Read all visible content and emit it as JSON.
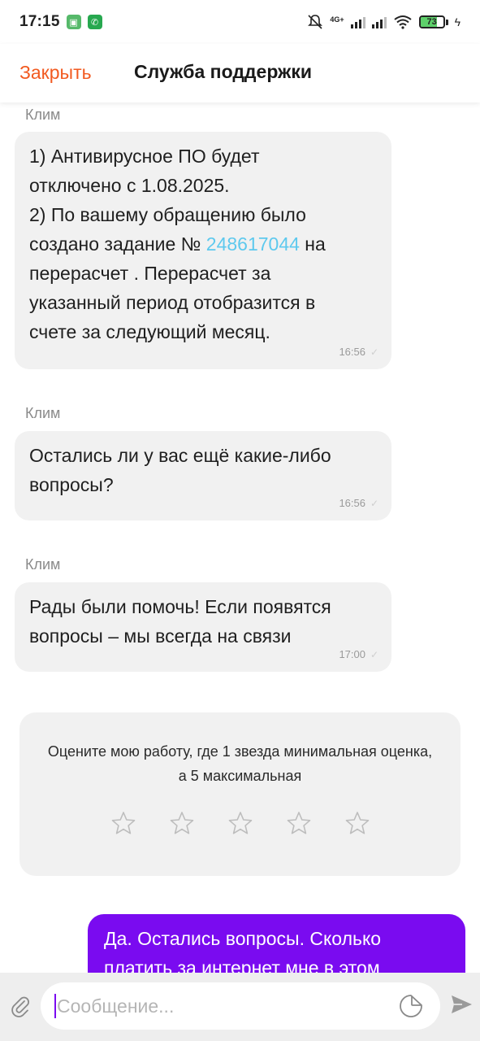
{
  "status_bar": {
    "time": "17:15",
    "network": "4G+",
    "battery": "73",
    "battery_level": 0.73
  },
  "header": {
    "close_label": "Закрыть",
    "title": "Служба поддержки"
  },
  "messages": [
    {
      "sender": "Клим",
      "text_before": "1) Антивирусное ПО будет\nотключено с 1.08.2025.\n2) По вашему обращению было\nсоздано задание № ",
      "link": "248617044",
      "text_after": " на\nперерасчет . Перерасчет за\nуказанный период отобразится в\nсчете за следующий месяц.",
      "time": "16:56"
    },
    {
      "sender": "Клим",
      "text": "Остались ли у вас ещё какие-либо\nвопросы?",
      "time": "16:56"
    },
    {
      "sender": "Клим",
      "text": "Рады были помочь! Если появятся\nвопросы – мы всегда на связи",
      "time": "17:00"
    }
  ],
  "rating": {
    "prompt": "Оцените мою работу, где 1 звезда минимальная оценка, а 5 максимальная",
    "stars": 5,
    "selected": 0
  },
  "outgoing": {
    "text": "Да. Остались вопросы. Сколько платить за интернет мне в этом"
  },
  "composer": {
    "placeholder": "Сообщение..."
  },
  "colors": {
    "accent_orange": "#f25a20",
    "outgoing_purple": "#7a0bf0",
    "link_blue": "#5ec9ee",
    "bubble_gray": "#f1f1f1"
  }
}
